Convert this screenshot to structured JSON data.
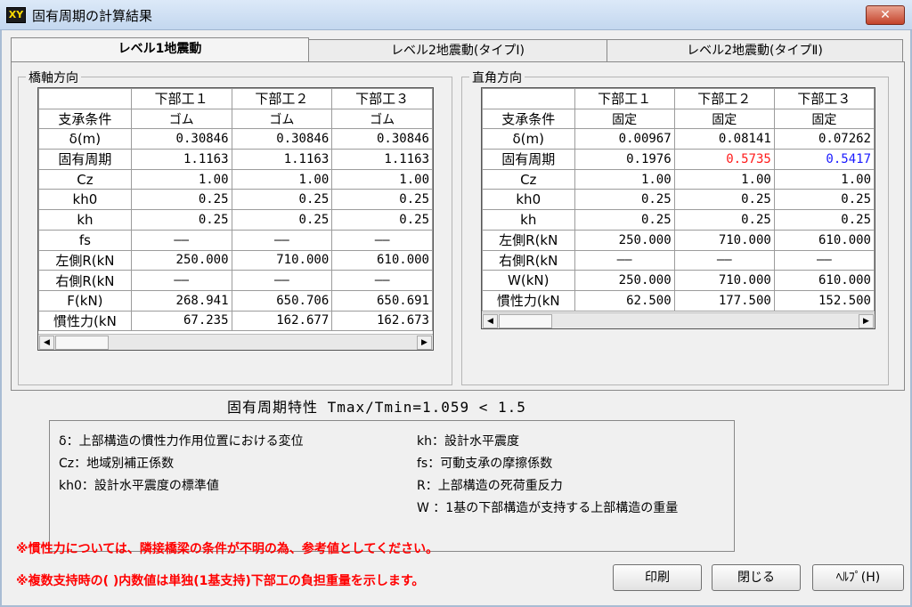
{
  "window": {
    "title": "固有周期の計算結果",
    "icon_text": "XY",
    "close_label": "✕"
  },
  "tabs": [
    {
      "label": "レベル1地震動",
      "active": true
    },
    {
      "label": "レベル2地震動(タイプⅠ)",
      "active": false
    },
    {
      "label": "レベル2地震動(タイプⅡ)",
      "active": false
    }
  ],
  "left_group": {
    "caption": "橋軸方向",
    "columns": [
      "下部工１",
      "下部工２",
      "下部工３"
    ],
    "rows": [
      {
        "label": "支承条件",
        "values": [
          "ゴム",
          "ゴム",
          "ゴム"
        ]
      },
      {
        "label": "δ(m)",
        "values": [
          "0.30846",
          "0.30846",
          "0.30846"
        ]
      },
      {
        "label": "固有周期",
        "values": [
          "1.1163",
          "1.1163",
          "1.1163"
        ]
      },
      {
        "label": "Cz",
        "values": [
          "1.00",
          "1.00",
          "1.00"
        ]
      },
      {
        "label": "kh0",
        "values": [
          "0.25",
          "0.25",
          "0.25"
        ]
      },
      {
        "label": "kh",
        "values": [
          "0.25",
          "0.25",
          "0.25"
        ]
      },
      {
        "label": "fs",
        "values": [
          "——",
          "——",
          "——"
        ]
      },
      {
        "label": "左側R(kN",
        "values": [
          "250.000",
          "710.000",
          "610.000"
        ]
      },
      {
        "label": "右側R(kN",
        "values": [
          "——",
          "——",
          "——"
        ]
      },
      {
        "label": "F(kN)",
        "values": [
          "268.941",
          "650.706",
          "650.691"
        ]
      },
      {
        "label": "慣性力(kN",
        "values": [
          "67.235",
          "162.677",
          "162.673"
        ]
      }
    ]
  },
  "right_group": {
    "caption": "直角方向",
    "columns": [
      "下部工１",
      "下部工２",
      "下部工３"
    ],
    "rows": [
      {
        "label": "支承条件",
        "values": [
          "固定",
          "固定",
          "固定"
        ]
      },
      {
        "label": "δ(m)",
        "values": [
          "0.00967",
          "0.08141",
          "0.07262"
        ]
      },
      {
        "label": "固有周期",
        "values": [
          "0.1976",
          "0.5735",
          "0.5417"
        ]
      },
      {
        "label": "Cz",
        "values": [
          "1.00",
          "1.00",
          "1.00"
        ]
      },
      {
        "label": "kh0",
        "values": [
          "0.25",
          "0.25",
          "0.25"
        ]
      },
      {
        "label": "kh",
        "values": [
          "0.25",
          "0.25",
          "0.25"
        ]
      },
      {
        "label": "左側R(kN",
        "values": [
          "250.000",
          "710.000",
          "610.000"
        ]
      },
      {
        "label": "右側R(kN",
        "values": [
          "——",
          "——",
          "——"
        ]
      },
      {
        "label": "W(kN)",
        "values": [
          "250.000",
          "710.000",
          "610.000"
        ]
      },
      {
        "label": "慣性力(kN",
        "values": [
          "62.500",
          "177.500",
          "152.500"
        ]
      }
    ],
    "highlight_colors": {
      "max": "#ff1a1a",
      "min": "#1a1aff"
    }
  },
  "period_summary": "固有周期特性 Tmax/Tmin=1.059 < 1.5",
  "legend": {
    "delta": "δ：上部構造の慣性力作用位置における変位",
    "cz": "Cz：地域別補正係数",
    "kh0": "kh0：設計水平震度の標準値",
    "kh": "kh：設計水平震度",
    "fs": "fs：可動支承の摩擦係数",
    "r": "R：上部構造の死荷重反力",
    "w": "W ：1基の下部構造が支持する上部構造の重量"
  },
  "notes": [
    "※慣性力については、隣接橋梁の条件が不明の為、参考値としてください。",
    "※複数支持時の( )内数値は単独(1基支持)下部工の負担重量を示します。"
  ],
  "buttons": {
    "print": "印刷",
    "close": "閉じる",
    "help": "ﾍﾙﾌﾟ(H)"
  },
  "scroll": {
    "left": "◀",
    "right": "▶"
  }
}
